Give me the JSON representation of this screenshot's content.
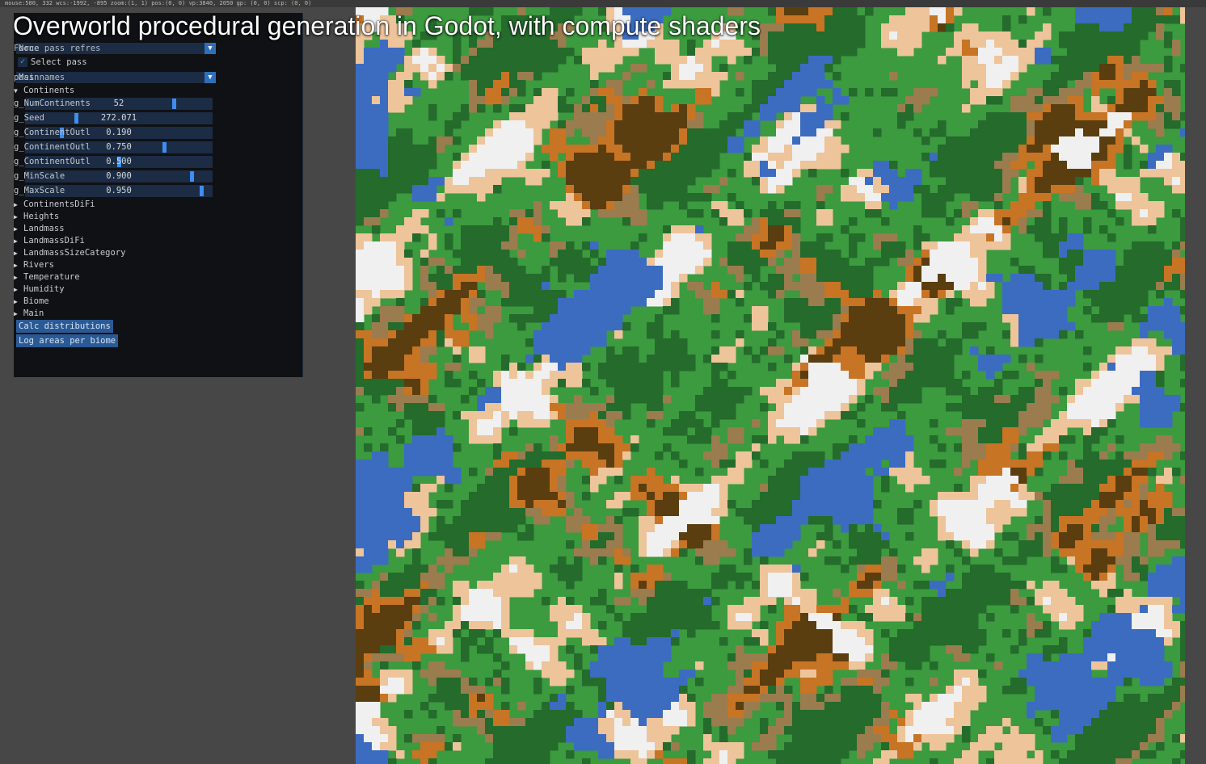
{
  "video_title": "Overworld procedural generation in Godot, with compute shaders",
  "top_status": "mouse:580, 332 wcs:-1992, -895 zoom:(1, 1) pos:(0, 0) vp:3840, 2050 gp: (0, 0) scp: (0, 0)",
  "panel": {
    "pass_combo": {
      "value": "None",
      "label": "Force pass refres"
    },
    "select_pass": {
      "checked": true,
      "label": "Select pass",
      "check_glyph": "✓"
    },
    "pass_names_combo": {
      "value": "Main",
      "label": "pass names"
    },
    "arrow_glyph": "▼",
    "section_open": {
      "label": "Continents",
      "glyph": "▼"
    },
    "sliders": [
      {
        "value": "52",
        "label": "g_NumContinents",
        "fraction": 0.8
      },
      {
        "value": "272.071",
        "label": "g_Seed",
        "fraction": 0.27
      },
      {
        "value": "0.190",
        "label": "g_ContinentOutl",
        "fraction": 0.19
      },
      {
        "value": "0.750",
        "label": "g_ContinentOutl",
        "fraction": 0.75
      },
      {
        "value": "0.500",
        "label": "g_ContinentOutl",
        "fraction": 0.5
      },
      {
        "value": "0.900",
        "label": "g_MinScale",
        "fraction": 0.9
      },
      {
        "value": "0.950",
        "label": "g_MaxScale",
        "fraction": 0.95
      }
    ],
    "collapsed_glyph": "▶",
    "collapsed_sections": [
      "ContinentsDiFi",
      "Heights",
      "Landmass",
      "LandmassDiFi",
      "LandmassSizeCategory",
      "Rivers",
      "Temperature",
      "Humidity",
      "Biome",
      "Main"
    ],
    "buttons": [
      "Calc distributions",
      "Log areas per biome"
    ]
  },
  "biome_colors": {
    "ocean": "#3b6cc0",
    "snow": "#f0f0f0",
    "sand": "#eec49b",
    "grass": "#3c9a3f",
    "forest": "#246b2c",
    "hills": "#9a7c4e",
    "desert": "#c77425",
    "mountain": "#5a3e10"
  }
}
